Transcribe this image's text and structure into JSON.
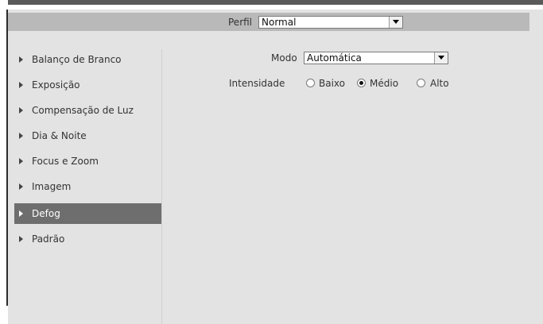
{
  "profile": {
    "label": "Perfil",
    "value": "Normal"
  },
  "sidebar": {
    "items": [
      {
        "label": "Balanço de Branco",
        "active": false
      },
      {
        "label": "Exposição",
        "active": false
      },
      {
        "label": "Compensação de Luz",
        "active": false
      },
      {
        "label": "Dia & Noite",
        "active": false
      },
      {
        "label": "Focus e Zoom",
        "active": false
      },
      {
        "label": "Imagem",
        "active": false
      },
      {
        "label": "Defog",
        "active": true
      },
      {
        "label": "Padrão",
        "active": false
      }
    ]
  },
  "mode": {
    "label": "Modo",
    "value": "Automática"
  },
  "intensity": {
    "label": "Intensidade",
    "options": [
      {
        "label": "Baixo",
        "selected": false
      },
      {
        "label": "Médio",
        "selected": true
      },
      {
        "label": "Alto",
        "selected": false
      }
    ]
  },
  "colors": {
    "active_item_bg": "#6e6e6e",
    "panel_bg": "#e3e3e3",
    "profile_bar_bg": "#b9b9b9"
  }
}
